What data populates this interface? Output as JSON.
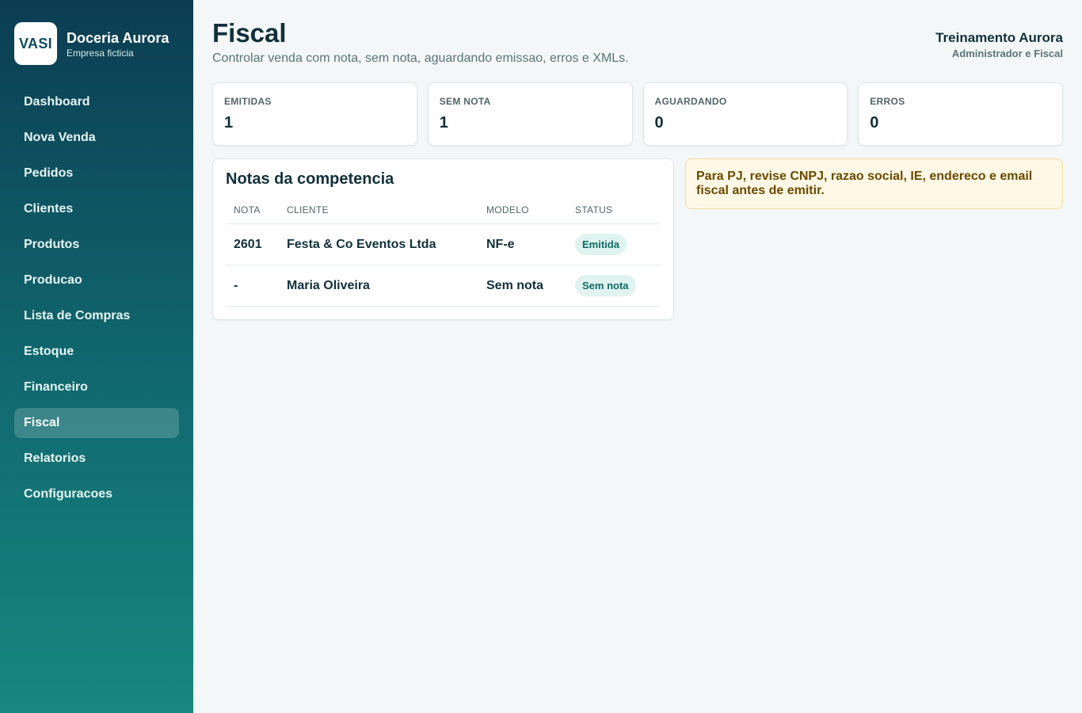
{
  "brand": {
    "logo_text": "VASI",
    "name": "Doceria Aurora",
    "subtitle": "Empresa ficticia"
  },
  "sidebar": {
    "items": [
      {
        "label": "Dashboard"
      },
      {
        "label": "Nova Venda"
      },
      {
        "label": "Pedidos"
      },
      {
        "label": "Clientes"
      },
      {
        "label": "Produtos"
      },
      {
        "label": "Producao"
      },
      {
        "label": "Lista de Compras"
      },
      {
        "label": "Estoque"
      },
      {
        "label": "Financeiro"
      },
      {
        "label": "Fiscal",
        "active": true
      },
      {
        "label": "Relatorios"
      },
      {
        "label": "Configuracoes"
      }
    ]
  },
  "header": {
    "title": "Fiscal",
    "subtitle": "Controlar venda com nota, sem nota, aguardando emissao, erros e XMLs."
  },
  "user": {
    "name": "Treinamento Aurora",
    "role": "Administrador e Fiscal"
  },
  "stats": [
    {
      "label": "EMITIDAS",
      "value": "1"
    },
    {
      "label": "SEM NOTA",
      "value": "1"
    },
    {
      "label": "AGUARDANDO",
      "value": "0"
    },
    {
      "label": "ERROS",
      "value": "0"
    }
  ],
  "notes_card": {
    "title": "Notas da competencia",
    "columns": [
      "NOTA",
      "CLIENTE",
      "MODELO",
      "STATUS"
    ],
    "rows": [
      {
        "nota": "2601",
        "cliente": "Festa & Co Eventos Ltda",
        "modelo": "NF-e",
        "status": "Emitida"
      },
      {
        "nota": "-",
        "cliente": "Maria Oliveira",
        "modelo": "Sem nota",
        "status": "Sem nota"
      }
    ]
  },
  "alert": {
    "text": "Para PJ, revise CNPJ, razao social, IE, endereco e email fiscal antes de emitir."
  },
  "colors": {
    "sidebar_top": "#0b3d52",
    "sidebar_bottom": "#17877f",
    "badge_bg": "#e0f3f1",
    "badge_text": "#0e6b62",
    "alert_bg": "#fff8e6",
    "alert_text": "#6b4a00"
  }
}
